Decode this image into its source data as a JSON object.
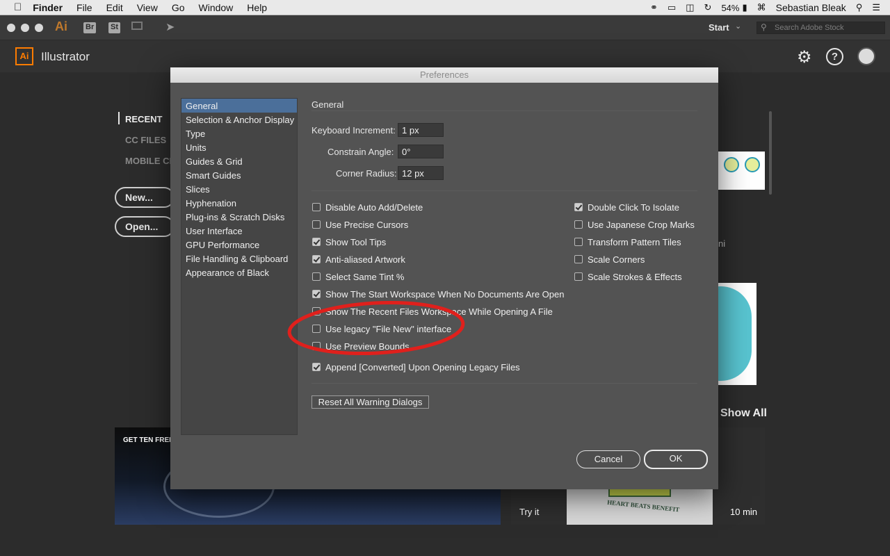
{
  "menubar": {
    "items": [
      "Finder",
      "File",
      "Edit",
      "View",
      "Go",
      "Window",
      "Help"
    ],
    "battery": "54%",
    "user": "Sebastian Bleak"
  },
  "toolbar": {
    "app_ai": "Ai",
    "app_br": "Br",
    "app_st": "St",
    "workspace": "Start",
    "search_placeholder": "Search Adobe Stock"
  },
  "app": {
    "logo": "Ai",
    "name": "Illustrator"
  },
  "start": {
    "recent": "RECENT",
    "cc_files": "CC FILES",
    "mobile": "MOBILE CR",
    "new_button": "New...",
    "open_button": "Open...",
    "show_all": "Show All",
    "banner_text": "GET TEN FREE I",
    "try_it": "Try it",
    "duration": "10 min",
    "tshirt_text": "HEART BEATS BENEFIT",
    "partial_text": "ni"
  },
  "dialog": {
    "title": "Preferences",
    "categories": [
      "General",
      "Selection & Anchor Display",
      "Type",
      "Units",
      "Guides & Grid",
      "Smart Guides",
      "Slices",
      "Hyphenation",
      "Plug-ins & Scratch Disks",
      "User Interface",
      "GPU Performance",
      "File Handling & Clipboard",
      "Appearance of Black"
    ],
    "section_title": "General",
    "fields": {
      "keyboard_increment": {
        "label": "Keyboard Increment:",
        "value": "1 px"
      },
      "constrain_angle": {
        "label": "Constrain Angle:",
        "value": "0°"
      },
      "corner_radius": {
        "label": "Corner Radius:",
        "value": "12 px"
      }
    },
    "left_checks": [
      {
        "label": "Disable Auto Add/Delete",
        "checked": false
      },
      {
        "label": "Use Precise Cursors",
        "checked": false
      },
      {
        "label": "Show Tool Tips",
        "checked": true
      },
      {
        "label": "Anti-aliased Artwork",
        "checked": true
      },
      {
        "label": "Select Same Tint %",
        "checked": false
      },
      {
        "label": "Show The Start Workspace When No Documents Are Open",
        "checked": true
      },
      {
        "label": "Show The Recent Files Workspace While Opening A File",
        "checked": false
      },
      {
        "label": "Use legacy \"File New\" interface",
        "checked": false
      },
      {
        "label": "Use Preview Bounds",
        "checked": false
      },
      {
        "label": "Append [Converted] Upon Opening Legacy Files",
        "checked": true
      }
    ],
    "right_checks": [
      {
        "label": "Double Click To Isolate",
        "checked": true
      },
      {
        "label": "Use Japanese Crop Marks",
        "checked": false
      },
      {
        "label": "Transform Pattern Tiles",
        "checked": false
      },
      {
        "label": "Scale Corners",
        "checked": false
      },
      {
        "label": "Scale Strokes & Effects",
        "checked": false
      }
    ],
    "reset_button": "Reset All Warning Dialogs",
    "cancel_button": "Cancel",
    "ok_button": "OK"
  },
  "colors": {
    "annotation_circle": "#e0201c",
    "selection": "#4b6f9a",
    "ai_orange": "#ff7c00"
  }
}
